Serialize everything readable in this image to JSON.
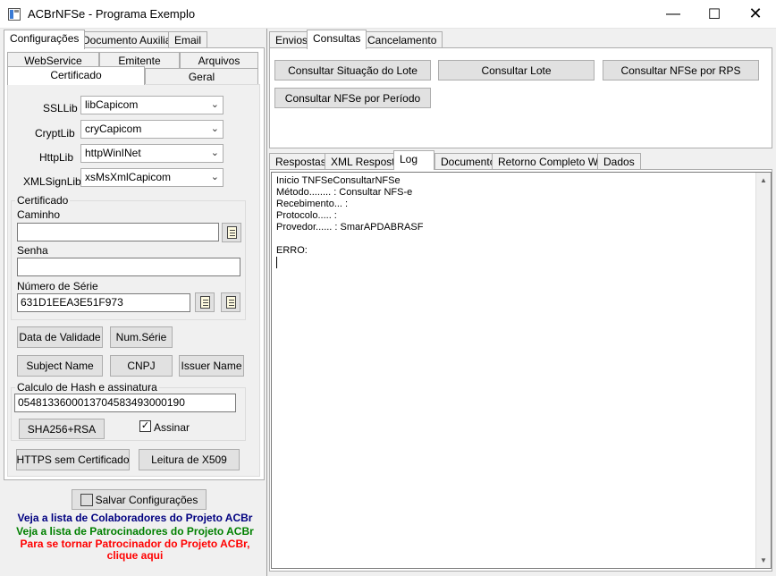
{
  "window": {
    "title": "ACBrNFSe - Programa Exemplo"
  },
  "left_tabs": [
    "Configurações",
    "Documento Auxiliar",
    "Email"
  ],
  "config_tabs": {
    "row1": [
      "WebService",
      "Emitente",
      "Arquivos"
    ],
    "row2": [
      "Certificado",
      "Geral"
    ]
  },
  "libs": {
    "ssllib": {
      "label": "SSLLib",
      "value": "libCapicom"
    },
    "cryptlib": {
      "label": "CryptLib",
      "value": "cryCapicom"
    },
    "httplib": {
      "label": "HttpLib",
      "value": "httpWinINet"
    },
    "xmlsignlib": {
      "label": "XMLSignLib",
      "value": "xsMsXmlCapicom"
    }
  },
  "certificado": {
    "group_title": "Certificado",
    "caminho_label": "Caminho",
    "caminho_value": "",
    "senha_label": "Senha",
    "senha_value": "",
    "serie_label": "Número de Série",
    "serie_value": "631D1EEA3E51F973"
  },
  "cert_buttons": {
    "data_validade": "Data de Validade",
    "num_serie": "Num.Série",
    "subject_name": "Subject Name",
    "cnpj": "CNPJ",
    "issuer_name": "Issuer Name"
  },
  "hash": {
    "group_title": "Calculo de Hash e assinatura",
    "value": "05481336000137045834930001​90",
    "sha_button": "SHA256+RSA",
    "assinar_label": "Assinar",
    "assinar_checked": true
  },
  "bottom_buttons": {
    "https": "HTTPS sem Certificado",
    "leitura": "Leitura de X509",
    "salvar": "Salvar Configurações"
  },
  "links": {
    "colaboradores": "Veja a lista de Colaboradores do Projeto ACBr",
    "patrocinadores": "Veja a lista de Patrocinadores do Projeto ACBr",
    "tornar_line1": "Para se tornar Patrocinador do Projeto ACBr,",
    "tornar_line2": "clique aqui"
  },
  "colors": {
    "colaboradores": "#000080",
    "patrocinadores": "#008000",
    "tornar": "#ff0000"
  },
  "right_tabs": [
    "Envios",
    "Consultas",
    "Cancelamento"
  ],
  "consultas_buttons": {
    "situacao_lote": "Consultar Situação do Lote",
    "lote": "Consultar Lote",
    "nfse_rps": "Consultar NFSe por RPS",
    "nfse_periodo": "Consultar NFSe por Período"
  },
  "result_tabs": [
    "Respostas",
    "XML Resposta",
    "Log",
    "Documento",
    "Retorno Completo WS",
    "Dados"
  ],
  "log_lines": [
    "Inicio TNFSeConsultarNFSe",
    "Método........ : Consultar NFS-e",
    "Recebimento... :",
    "Protocolo..... :",
    "Provedor...... : SmarAPDABRASF",
    "",
    "ERRO:"
  ]
}
